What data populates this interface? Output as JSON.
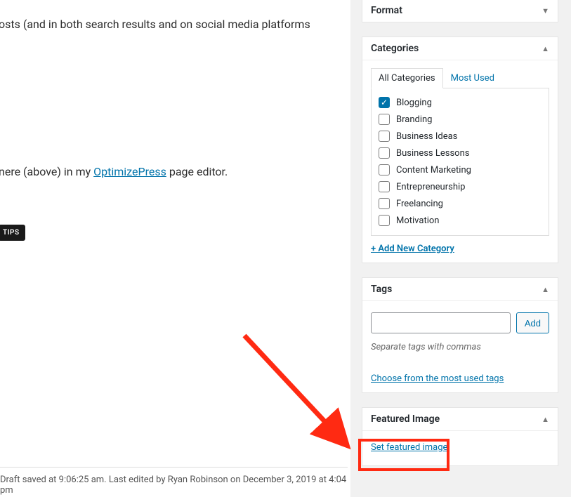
{
  "editor": {
    "line1": "osts (and in both search results and on social media platforms",
    "line2a": "nere (above) in my ",
    "line2_link": "OptimizePress",
    "line2b": " page editor.",
    "tips_chip": "TIPS"
  },
  "status": {
    "text": "Draft saved at 9:06:25 am. Last edited by Ryan Robinson on December 3, 2019 at 4:04 pm"
  },
  "panels": {
    "format": {
      "title": "Format"
    },
    "categories": {
      "title": "Categories",
      "tab_all": "All Categories",
      "tab_most": "Most Used",
      "items": [
        {
          "label": "Blogging",
          "checked": true
        },
        {
          "label": "Branding",
          "checked": false
        },
        {
          "label": "Business Ideas",
          "checked": false
        },
        {
          "label": "Business Lessons",
          "checked": false
        },
        {
          "label": "Content Marketing",
          "checked": false
        },
        {
          "label": "Entrepreneurship",
          "checked": false
        },
        {
          "label": "Freelancing",
          "checked": false
        },
        {
          "label": "Motivation",
          "checked": false
        }
      ],
      "add_new": "+ Add New Category"
    },
    "tags": {
      "title": "Tags",
      "add_btn": "Add",
      "hint": "Separate tags with commas",
      "choose_link": "Choose from the most used tags"
    },
    "featured": {
      "title": "Featured Image",
      "set_link": "Set featured image"
    }
  }
}
